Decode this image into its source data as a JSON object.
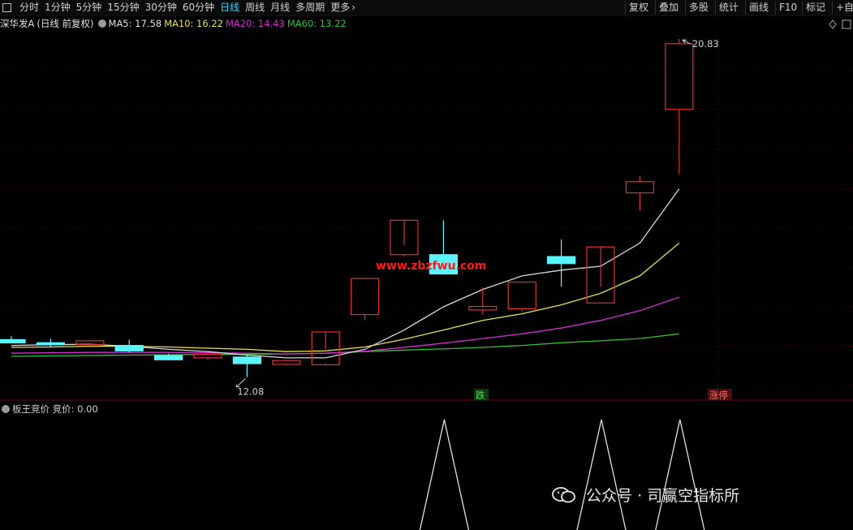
{
  "toolbar": {
    "left_items": [
      "分时",
      "1分钟",
      "5分钟",
      "15分钟",
      "30分钟",
      "60分钟",
      "日线",
      "周线",
      "月线",
      "多周期",
      "更多"
    ],
    "active_item": "日线",
    "right_items": [
      "复权",
      "叠加",
      "多股",
      "统计",
      "画线",
      "F10",
      "标记",
      "+自"
    ]
  },
  "legend": {
    "stock": "深华发A",
    "mode": "(日线 前复权)",
    "ma5": "MA5: 17.58",
    "ma10": "MA10: 16.22",
    "ma20": "MA20: 14.43",
    "ma60": "MA60: 13.22"
  },
  "colors": {
    "up": "#e23030",
    "down": "#5cf5ff",
    "ma5": "#d8d8d8",
    "ma10": "#e8e04a",
    "ma20": "#d030d0",
    "ma60": "#30c030",
    "watermark": "#ff1a1a"
  },
  "annotations": {
    "high_label": "20.83",
    "low_label": "12.08",
    "tag_die": "跌",
    "tag_zhangting": "涨停",
    "watermark_text": "www.zbzfwu.com"
  },
  "indicator": {
    "name": "板王竞价",
    "value_text": "竞价: 0.00",
    "peaks_at_bars": [
      11,
      15,
      17
    ]
  },
  "chart_data": {
    "type": "candlestick",
    "price_axis": {
      "ylim": [
        11.8,
        21.0
      ]
    },
    "candles": [
      {
        "o": 13.02,
        "h": 13.14,
        "l": 12.96,
        "c": 13.0
      },
      {
        "o": 12.97,
        "h": 13.07,
        "l": 12.86,
        "c": 12.92
      },
      {
        "o": 12.95,
        "h": 13.01,
        "l": 12.9,
        "c": 12.99
      },
      {
        "o": 12.9,
        "h": 13.05,
        "l": 12.72,
        "c": 12.76
      },
      {
        "o": 12.64,
        "h": 12.69,
        "l": 12.51,
        "c": 12.53
      },
      {
        "o": 12.61,
        "h": 12.66,
        "l": 12.53,
        "c": 12.64
      },
      {
        "o": 12.6,
        "h": 12.64,
        "l": 12.08,
        "c": 12.43
      },
      {
        "o": 12.41,
        "h": 12.5,
        "l": 12.38,
        "c": 12.51
      },
      {
        "o": 12.4,
        "h": 12.8,
        "l": 12.43,
        "c": 13.25
      },
      {
        "o": 13.7,
        "h": 14.65,
        "l": 13.55,
        "c": 14.63
      },
      {
        "o": 15.25,
        "h": 15.5,
        "l": 15.2,
        "c": 16.14
      },
      {
        "o": 15.25,
        "h": 16.14,
        "l": 14.76,
        "c": 14.75
      },
      {
        "o": 13.85,
        "h": 14.4,
        "l": 13.7,
        "c": 13.88
      },
      {
        "o": 13.85,
        "h": 14.52,
        "l": 13.78,
        "c": 14.54
      },
      {
        "o": 15.2,
        "h": 15.64,
        "l": 14.42,
        "c": 15.02
      },
      {
        "o": 14.0,
        "h": 14.42,
        "l": 14.0,
        "c": 15.45
      },
      {
        "o": 16.85,
        "h": 17.28,
        "l": 16.4,
        "c": 17.14
      },
      {
        "o": 19.01,
        "h": 20.83,
        "l": 17.33,
        "c": 20.71
      }
    ],
    "ma5": [
      12.9,
      12.92,
      12.93,
      12.88,
      12.8,
      12.74,
      12.65,
      12.58,
      12.58,
      12.8,
      13.3,
      13.9,
      14.35,
      14.7,
      14.85,
      14.95,
      15.55,
      16.95
    ],
    "ma10": [
      12.85,
      12.86,
      12.88,
      12.88,
      12.86,
      12.83,
      12.8,
      12.74,
      12.76,
      12.86,
      13.06,
      13.3,
      13.55,
      13.72,
      13.95,
      14.25,
      14.7,
      15.55
    ],
    "ma20": [
      12.7,
      12.71,
      12.72,
      12.72,
      12.72,
      12.71,
      12.7,
      12.68,
      12.7,
      12.75,
      12.85,
      12.96,
      13.08,
      13.2,
      13.35,
      13.55,
      13.8,
      14.15
    ],
    "ma60": [
      12.62,
      12.63,
      12.64,
      12.65,
      12.66,
      12.67,
      12.67,
      12.68,
      12.7,
      12.74,
      12.78,
      12.81,
      12.85,
      12.9,
      12.97,
      13.02,
      13.08,
      13.2
    ]
  }
}
